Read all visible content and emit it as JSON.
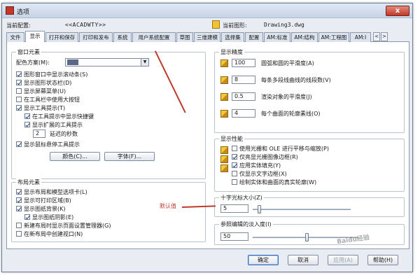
{
  "window": {
    "title": "选项",
    "close_label": "x"
  },
  "profile": {
    "current_config_label": "当前配置:",
    "current_config_value": "<<ACADWTY>>",
    "current_drawing_label": "当前图形:",
    "current_drawing_value": "Drawing3.dwg"
  },
  "tabs": [
    "文件",
    "显示",
    "打开和保存",
    "打印和发布",
    "系统",
    "用户系统配置",
    "草图",
    "三维建模",
    "选择集",
    "配置",
    "AM:标准",
    "AM:结构",
    "AM:工程图",
    "AM:Ⅰ"
  ],
  "active_tab": "显示",
  "tab_scroll": {
    "left": "<",
    "right": ">"
  },
  "window_elements": {
    "title": "窗口元素",
    "color_scheme_label": "配色方案(M):",
    "checkboxes": [
      {
        "label": "图形窗口中显示滚动条(S)",
        "checked": true
      },
      {
        "label": "显示图形状态栏(D)",
        "checked": true
      },
      {
        "label": "显示屏幕菜单(U)",
        "checked": false
      },
      {
        "label": "在工具栏中使用大按钮",
        "checked": false
      },
      {
        "label": "显示工具提示(T)",
        "checked": true
      },
      {
        "label": "在工具提示中显示快捷键",
        "checked": true
      },
      {
        "label": "显示扩展的工具提示",
        "checked": true
      }
    ],
    "delay_value": "2",
    "delay_label": "延迟的秒数",
    "rollover_label": "显示鼠标悬停工具提示",
    "rollover_checked": true,
    "colors_button": "颜色(C)...",
    "fonts_button": "字体(F)..."
  },
  "layout_elements": {
    "title": "布局元素",
    "checkboxes": [
      {
        "label": "显示布局和模型选项卡(L)",
        "checked": true,
        "indent": false
      },
      {
        "label": "显示可打印区域(B)",
        "checked": true,
        "indent": false
      },
      {
        "label": "显示图纸背景(K)",
        "checked": true,
        "indent": false
      },
      {
        "label": "显示图纸阴影(E)",
        "checked": true,
        "indent": true
      },
      {
        "label": "新建布局时显示页面设置管理器(G)",
        "checked": false,
        "indent": false
      },
      {
        "label": "在新布局中创建视口(N)",
        "checked": false,
        "indent": false
      }
    ]
  },
  "display_resolution": {
    "title": "显示精度",
    "rows": [
      {
        "value": "100",
        "label": "圆弧和圆的平滑度(A)"
      },
      {
        "value": "8",
        "label": "每条多段线曲线的线段数(V)"
      },
      {
        "value": "0.5",
        "label": "渲染对象的平滑度(J)"
      },
      {
        "value": "4",
        "label": "每个曲面的轮廓素线(O)"
      }
    ]
  },
  "display_performance": {
    "title": "显示性能",
    "checkboxes": [
      {
        "label": "使用光栅和 OLE 进行平移与缩放(P)",
        "checked": false
      },
      {
        "label": "仅亮显光栅图像边框(R)",
        "checked": true
      },
      {
        "label": "应用实体填充(Y)",
        "checked": true
      },
      {
        "label": "仅显示文字边框(X)",
        "checked": false
      },
      {
        "label": "绘制实体和曲面的真实轮廓(W)",
        "checked": false
      }
    ]
  },
  "crosshair": {
    "title": "十字光标大小(Z)",
    "value": "5",
    "level_percent": 5
  },
  "fade_control": {
    "title": "参照编辑的淡入度(I)",
    "value": "50",
    "level_percent": 50
  },
  "annotation": {
    "text": "默认值"
  },
  "buttons": {
    "ok": "确定",
    "cancel": "取消",
    "apply": "应用(A)",
    "help": "帮助(H)"
  },
  "watermark": "Baidu经验"
}
